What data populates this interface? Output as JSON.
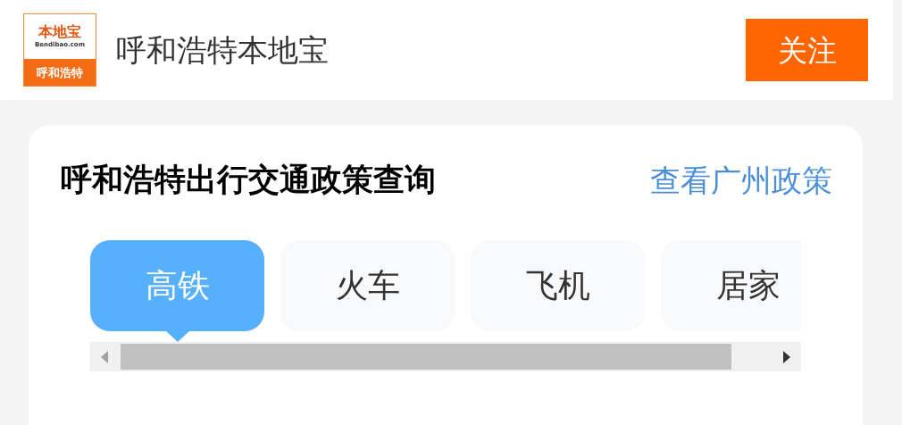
{
  "header": {
    "logo": {
      "brand": "本地宝",
      "domain": "Bendibao.com",
      "city": "呼和浩特"
    },
    "title": "呼和浩特本地宝",
    "follow_button": "关注"
  },
  "card": {
    "title": "呼和浩特出行交通政策查询",
    "link": "查看广州政策",
    "tabs": [
      {
        "label": "高铁",
        "selected": true
      },
      {
        "label": "火车",
        "selected": false
      },
      {
        "label": "飞机",
        "selected": false
      },
      {
        "label": "居家",
        "selected": false
      }
    ]
  }
}
